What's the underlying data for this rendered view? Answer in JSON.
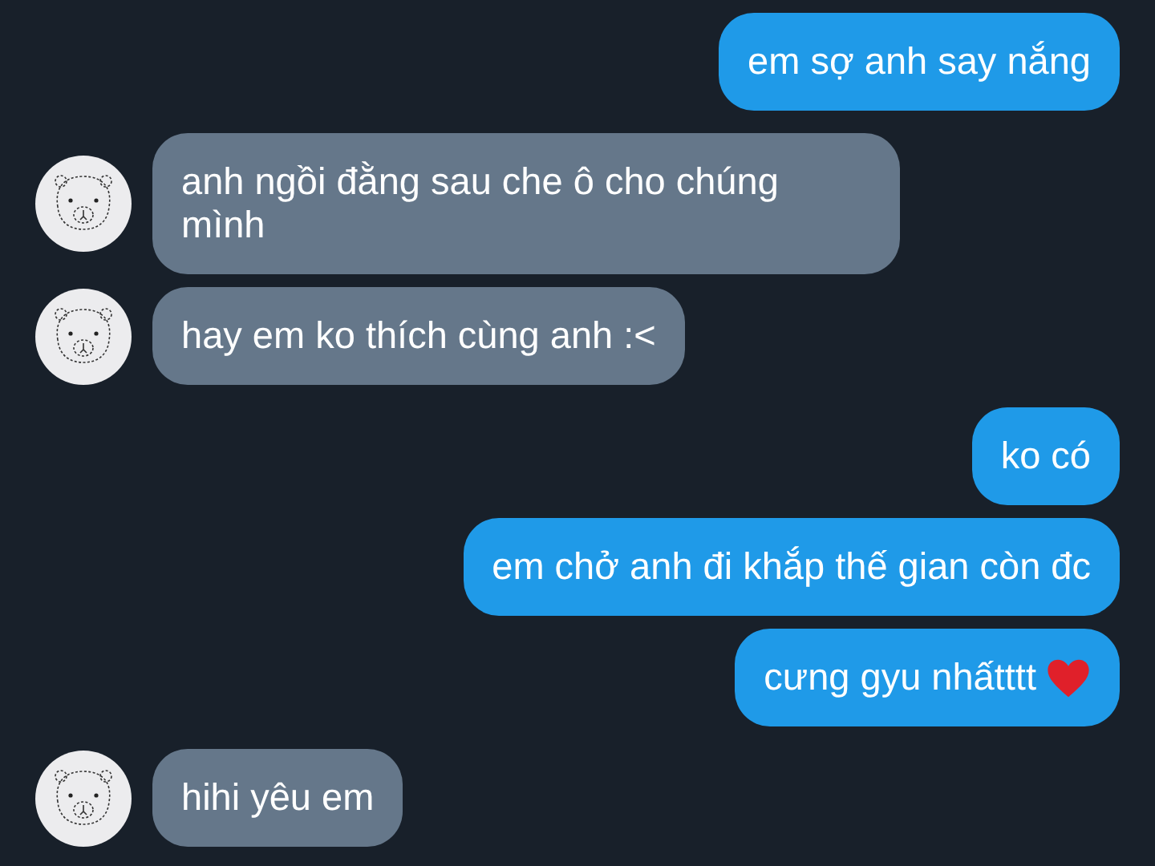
{
  "messages": [
    {
      "kind": "outgoing",
      "text": "em sợ anh say nắng",
      "heart": false
    },
    {
      "kind": "incoming",
      "text": "anh ngồi đằng sau che ô cho chúng mình",
      "heart": false
    },
    {
      "kind": "incoming",
      "text": "hay em ko thích cùng anh :<",
      "heart": false
    },
    {
      "kind": "outgoing",
      "text": "ko có",
      "heart": false
    },
    {
      "kind": "outgoing",
      "text": "em chở anh đi khắp thế gian còn đc",
      "heart": false
    },
    {
      "kind": "outgoing",
      "text": "cưng gyu nhấtttt",
      "heart": true
    },
    {
      "kind": "incoming",
      "text": "hihi yêu em",
      "heart": false
    }
  ]
}
